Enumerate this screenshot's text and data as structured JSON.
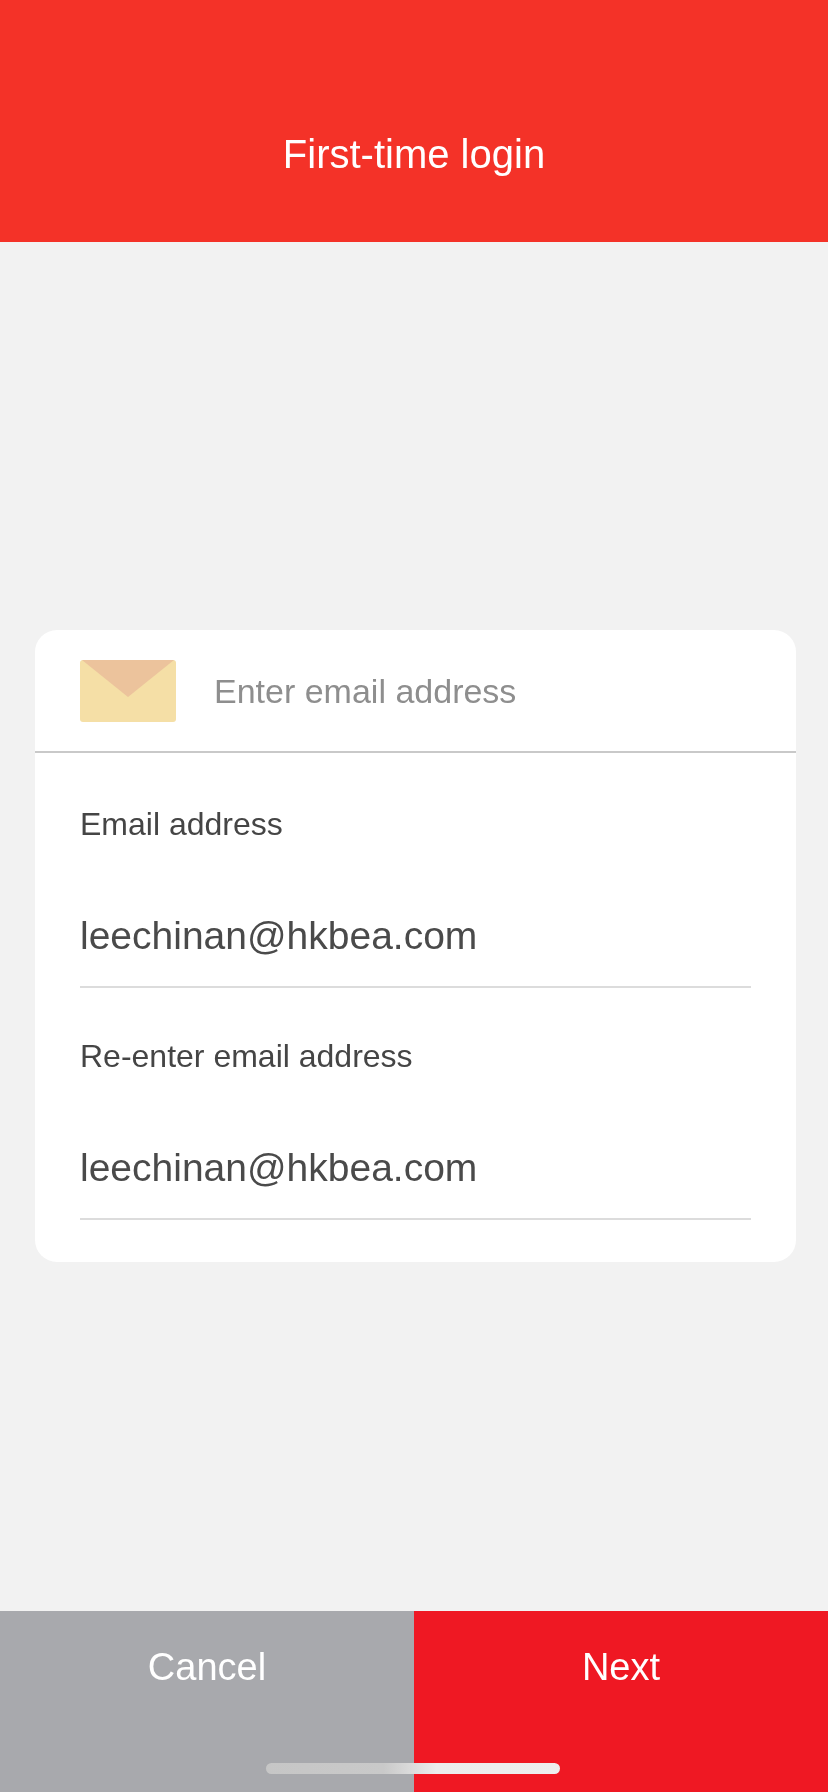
{
  "header": {
    "title": "First-time login"
  },
  "form": {
    "email_input": {
      "placeholder": "Enter email address"
    },
    "fields": [
      {
        "label": "Email address",
        "value": "leechinan@hkbea.com"
      },
      {
        "label": "Re-enter email address",
        "value": "leechinan@hkbea.com"
      }
    ]
  },
  "buttons": [
    {
      "label": "Cancel",
      "kind": "secondary"
    },
    {
      "label": "Next",
      "kind": "primary"
    }
  ]
}
